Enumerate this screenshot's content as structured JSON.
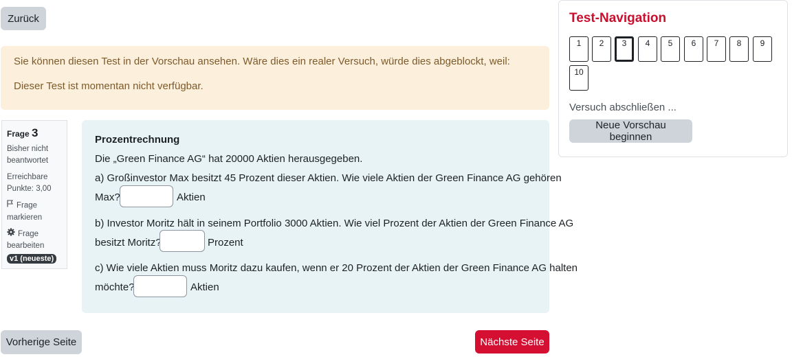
{
  "back_button": "Zurück",
  "alert": {
    "line1": "Sie können diesen Test in der Vorschau ansehen. Wäre dies ein realer Versuch, würde dies abgeblockt, weil:",
    "line2": "Dieser Test ist momentan nicht verfügbar."
  },
  "question_info": {
    "label": "Frage",
    "number": "3",
    "state_line1": "Bisher nicht",
    "state_line2": "beantwortet",
    "grade_line1": "Erreichbare",
    "grade_line2": "Punkte: 3,00",
    "flag_line1": "Frage",
    "flag_line2": "markieren",
    "edit_line1": "Frage",
    "edit_line2": "bearbeiten",
    "version_badge": "v1 (neueste)"
  },
  "question": {
    "title": "Prozentrechnung",
    "intro": "Die „Green Finance AG“ hat 20000 Aktien herausgegeben.",
    "a_line1": "a) Großinvestor Max besitzt 45 Prozent dieser Aktien. Wie viele Aktien der Green Finance AG gehören",
    "a_line2": "Max?",
    "a_unit": "Aktien",
    "a_value": "",
    "b_line1": "b) Investor Moritz hält in seinem Portfolio 3000 Aktien. Wie viel Prozent der Aktien der Green Finance AG",
    "b_line2": "besitzt Moritz?",
    "b_unit": "Prozent",
    "b_value": "",
    "c_line1": "c) Wie viele Aktien muss Moritz dazu kaufen, wenn er 20 Prozent der Aktien der Green Finance AG halten",
    "c_line2": "möchte?",
    "c_unit": "Aktien",
    "c_value": ""
  },
  "footer": {
    "prev": "Vorherige Seite",
    "next": "Nächste Seite"
  },
  "navigation": {
    "title": "Test-Navigation",
    "pages": [
      "1",
      "2",
      "3",
      "4",
      "5",
      "6",
      "7",
      "8",
      "9",
      "10"
    ],
    "current_page": "3",
    "finish": "Versuch abschließen ...",
    "new_preview": "Neue Vorschau beginnen"
  },
  "colors": {
    "accent_red": "#d40f32",
    "title_red": "#c8102e",
    "alert_bg": "#fcefdc",
    "question_bg": "#e7f3f5",
    "button_grey": "#ced4da"
  },
  "icons": {
    "flag": "flag-icon",
    "edit": "gear-icon"
  }
}
